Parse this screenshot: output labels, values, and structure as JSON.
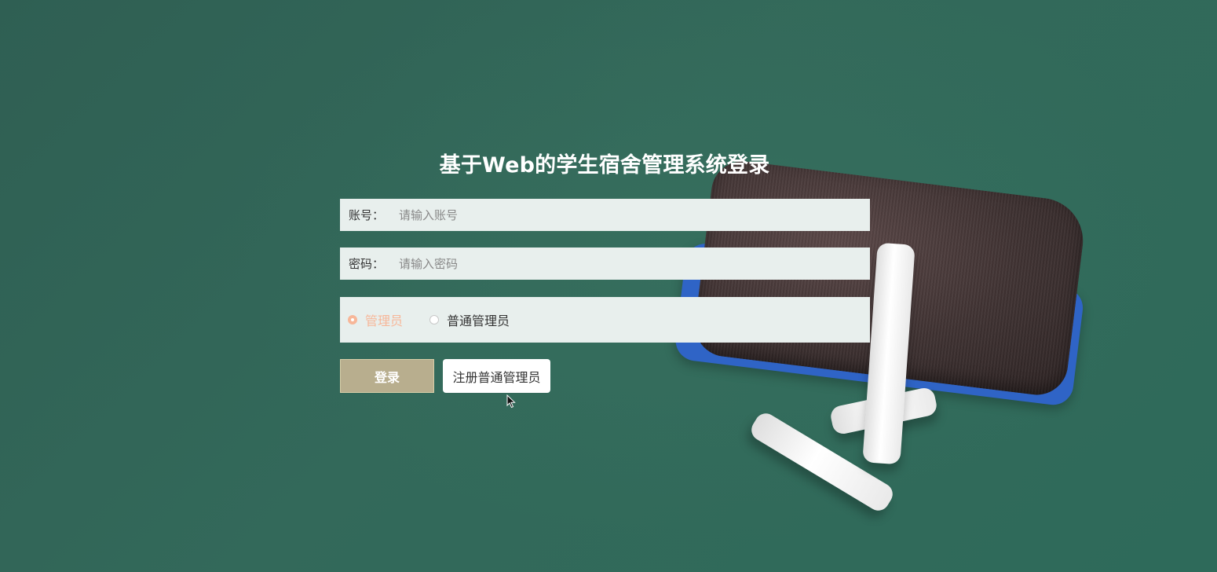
{
  "title": "基于Web的学生宿舍管理系统登录",
  "form": {
    "account_label": "账号：",
    "account_placeholder": "请输入账号",
    "password_label": "密码：",
    "password_placeholder": "请输入密码",
    "roles": [
      {
        "label": "管理员",
        "selected": true
      },
      {
        "label": "普通管理员",
        "selected": false
      }
    ],
    "login_label": "登录",
    "register_label": "注册普通管理员"
  },
  "colors": {
    "background": "#33695a",
    "field_bg": "#e8efed",
    "selected_accent": "#f7b799",
    "login_button": "#b8ae8e"
  },
  "icons": [
    "mouse-cursor-icon"
  ]
}
